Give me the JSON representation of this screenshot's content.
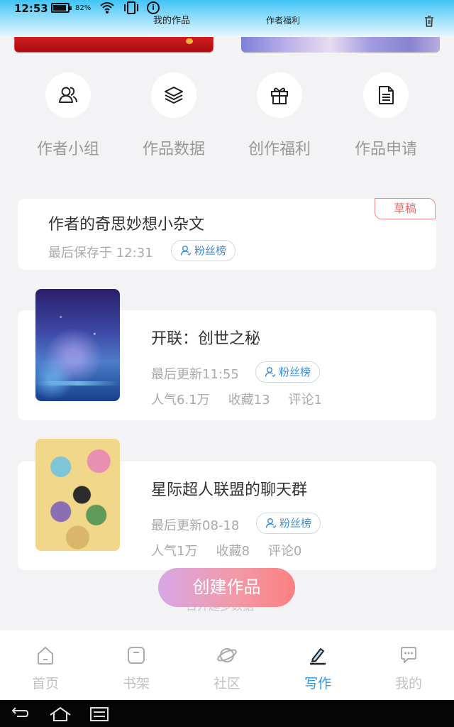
{
  "status": {
    "time": "12:53",
    "battery_pct": "82%",
    "battery_level": 0.82
  },
  "header": {
    "tab_works": "我的作品",
    "tab_welfare": "作者福利"
  },
  "quick_actions": [
    {
      "label": "作者小组",
      "icon": "people-icon"
    },
    {
      "label": "作品数据",
      "icon": "layers-icon"
    },
    {
      "label": "创作福利",
      "icon": "gift-icon"
    },
    {
      "label": "作品申请",
      "icon": "document-icon"
    }
  ],
  "draft": {
    "title": "作者的奇思妙想小杂文",
    "saved": "最后保存于 12:31",
    "fans": "粉丝榜",
    "badge": "草稿"
  },
  "works": [
    {
      "title": "开联：创世之秘",
      "updated": "最后更新11:55",
      "fans": "粉丝榜",
      "popularity": "人气6.1万",
      "favorites": "收藏13",
      "comments": "评论1"
    },
    {
      "title": "星际超人联盟的聊天群",
      "updated": "最后更新08-18",
      "fans": "粉丝榜",
      "popularity": "人气1万",
      "favorites": "收藏8",
      "comments": "评论0"
    }
  ],
  "create_button": "创建作品",
  "ghost_text": "日开趣多数据",
  "nav": [
    {
      "label": "首页",
      "icon": "home-icon",
      "active": false
    },
    {
      "label": "书架",
      "icon": "bookshelf-icon",
      "active": false
    },
    {
      "label": "社区",
      "icon": "planet-icon",
      "active": false
    },
    {
      "label": "写作",
      "icon": "pen-icon",
      "active": true
    },
    {
      "label": "我的",
      "icon": "chat-icon",
      "active": false
    }
  ],
  "colors": {
    "accent": "#2a96e6",
    "draft": "#ef6b6b",
    "create_from": "#d6a7e6",
    "create_to": "#fc8080"
  }
}
